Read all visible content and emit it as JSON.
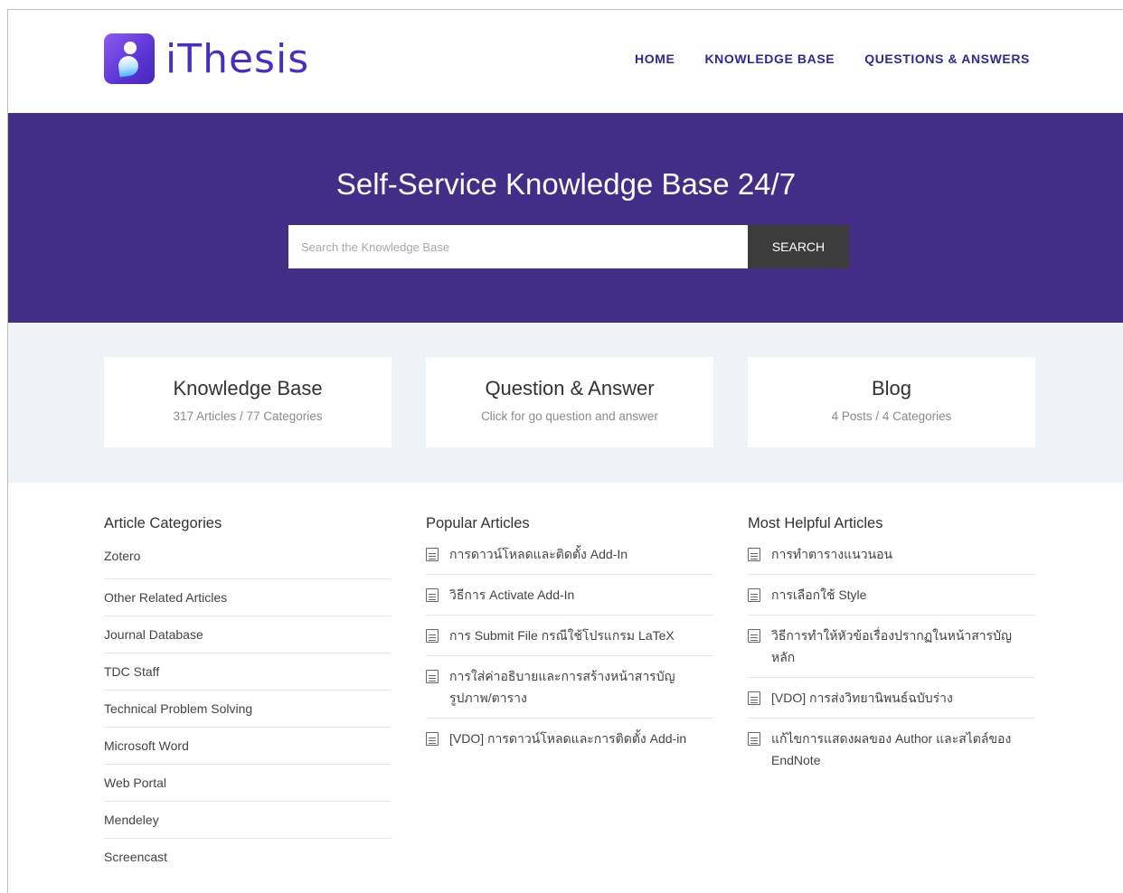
{
  "brand": {
    "name": "iThesis",
    "color": "#4a2fbd",
    "icon": "ithesis-logo-icon"
  },
  "nav": [
    {
      "label": "HOME"
    },
    {
      "label": "KNOWLEDGE BASE"
    },
    {
      "label": "QUESTIONS & ANSWERS"
    }
  ],
  "hero": {
    "title": "Self-Service Knowledge Base 24/7",
    "background": "#432d86",
    "search_placeholder": "Search the Knowledge Base",
    "search_button": "SEARCH"
  },
  "cards": [
    {
      "title": "Knowledge Base",
      "subtitle": "317 Articles / 77 Categories"
    },
    {
      "title": "Question & Answer",
      "subtitle": "Click for go question and answer"
    },
    {
      "title": "Blog",
      "subtitle": "4 Posts / 4 Categories"
    }
  ],
  "article_categories": {
    "heading": "Article Categories",
    "items": [
      "Zotero",
      "Other Related Articles",
      "Journal Database",
      "TDC Staff",
      "Technical Problem Solving",
      "Microsoft Word",
      "Web Portal",
      "Mendeley",
      "Screencast"
    ]
  },
  "popular_articles": {
    "heading": "Popular Articles",
    "icon": "document-icon",
    "items": [
      "การดาวน์โหลดและติดตั้ง Add-In",
      "วิธีการ Activate Add-In",
      "การ Submit File กรณีใช้โปรแกรม LaTeX",
      "การใส่ค่าอธิบายและการสร้างหน้าสารบัญรูปภาพ/ตาราง",
      "[VDO] การดาวน์โหลดและการติดตั้ง Add-in"
    ]
  },
  "most_helpful_articles": {
    "heading": "Most Helpful Articles",
    "icon": "document-icon",
    "items": [
      "การทำตารางแนวนอน",
      "การเลือกใช้ Style",
      "วิธีการทำให้หัวข้อเรื่องปรากฏในหน้าสารบัญหลัก",
      "[VDO] การส่งวิทยานิพนธ์ฉบับร่าง",
      "แก้ไขการแสดงผลของ Author และสไตล์ของ EndNote"
    ]
  }
}
